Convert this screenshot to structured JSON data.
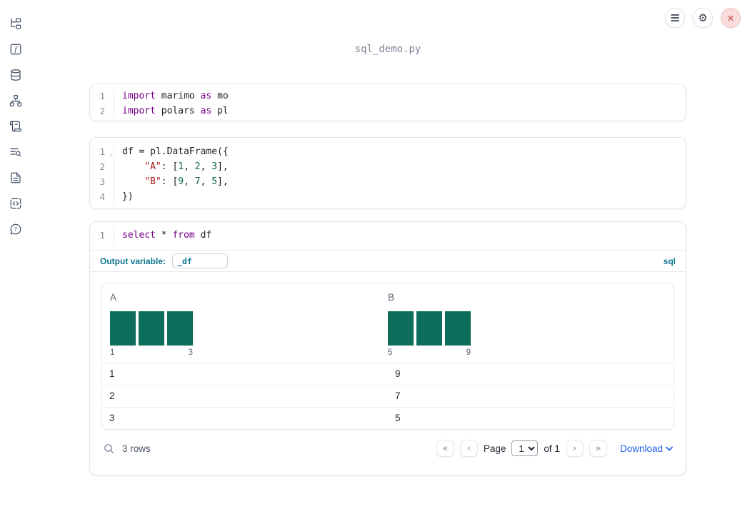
{
  "app": {
    "title": "sql_demo.py"
  },
  "header": {
    "buttons": [
      {
        "name": "notebook-menu",
        "icon": "hamburger-icon"
      },
      {
        "name": "settings",
        "icon": "gear-icon"
      },
      {
        "name": "shutdown",
        "icon": "close-icon",
        "close_glyph": "×"
      }
    ]
  },
  "sidebar": {
    "items": [
      {
        "name": "file-explorer"
      },
      {
        "name": "variables"
      },
      {
        "name": "data-sources"
      },
      {
        "name": "dependencies"
      },
      {
        "name": "scratchpad"
      },
      {
        "name": "logs"
      },
      {
        "name": "documentation"
      },
      {
        "name": "snippets"
      },
      {
        "name": "help"
      }
    ]
  },
  "cells": [
    {
      "id": "imports-cell",
      "lines": [
        {
          "n": "1",
          "tokens": [
            [
              "kw",
              "import"
            ],
            [
              "pl",
              " marimo "
            ],
            [
              "kw",
              "as"
            ],
            [
              "pl",
              " mo"
            ]
          ]
        },
        {
          "n": "2",
          "tokens": [
            [
              "kw",
              "import"
            ],
            [
              "pl",
              " polars "
            ],
            [
              "kw",
              "as"
            ],
            [
              "pl",
              " pl"
            ]
          ]
        }
      ]
    },
    {
      "id": "dataframe-cell",
      "lines": [
        {
          "n": "1",
          "fold": true,
          "tokens": [
            [
              "pl",
              "df = pl.DataFrame({"
            ]
          ]
        },
        {
          "n": "2",
          "tokens": [
            [
              "pl",
              "    "
            ],
            [
              "str",
              "\"A\""
            ],
            [
              "pl",
              ": ["
            ],
            [
              "num",
              "1"
            ],
            [
              "pl",
              ", "
            ],
            [
              "num",
              "2"
            ],
            [
              "pl",
              ", "
            ],
            [
              "num",
              "3"
            ],
            [
              "pl",
              "],"
            ]
          ]
        },
        {
          "n": "3",
          "tokens": [
            [
              "pl",
              "    "
            ],
            [
              "str",
              "\"B\""
            ],
            [
              "pl",
              ": ["
            ],
            [
              "num",
              "9"
            ],
            [
              "pl",
              ", "
            ],
            [
              "num",
              "7"
            ],
            [
              "pl",
              ", "
            ],
            [
              "num",
              "5"
            ],
            [
              "pl",
              "],"
            ]
          ]
        },
        {
          "n": "4",
          "tokens": [
            [
              "pl",
              "})"
            ]
          ]
        }
      ]
    },
    {
      "id": "sql-cell",
      "lines": [
        {
          "n": "1",
          "tokens": [
            [
              "kw",
              "select"
            ],
            [
              "pl",
              " * "
            ],
            [
              "kw",
              "from"
            ],
            [
              "pl",
              " df"
            ]
          ]
        }
      ]
    }
  ],
  "sql_cell": {
    "output_variable_label": "Output variable:",
    "output_variable_value": "_df",
    "language_label": "sql"
  },
  "table": {
    "columns": [
      {
        "name": "A",
        "histogram": {
          "bar_heights": [
            1,
            1,
            1
          ],
          "min_label": "1",
          "max_label": "3"
        }
      },
      {
        "name": "B",
        "histogram": {
          "bar_heights": [
            1,
            1,
            1
          ],
          "min_label": "5",
          "max_label": "9"
        }
      }
    ],
    "rows": [
      [
        "1",
        "9"
      ],
      [
        "2",
        "7"
      ],
      [
        "3",
        "5"
      ]
    ]
  },
  "footer": {
    "row_count": "3 rows",
    "page_label": "Page",
    "page_value": "1",
    "of_label": "of 1",
    "download_label": "Download",
    "pagination": [
      {
        "name": "first-page",
        "glyph": "«"
      },
      {
        "name": "prev-page",
        "glyph": "‹"
      },
      {
        "name": "next-page",
        "glyph": "›"
      },
      {
        "name": "last-page",
        "glyph": "»"
      }
    ]
  },
  "colors": {
    "keyword": "#770088",
    "string": "#aa1111",
    "number": "#116644",
    "accent_teal": "#0e7490",
    "histogram_bar": "#0e6e5c",
    "download_blue": "#2563eb",
    "close_button_bg": "#f9dbdb",
    "close_button_x": "#cc4646"
  }
}
